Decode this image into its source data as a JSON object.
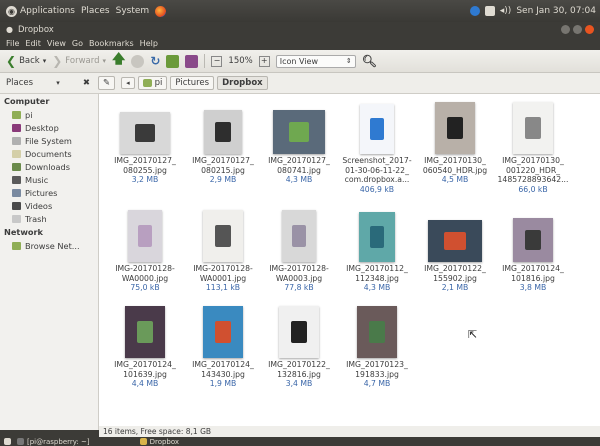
{
  "topbar": {
    "applications": "Applications",
    "places": "Places",
    "system": "System",
    "datetime": "Sen Jan 30, 07:04"
  },
  "window": {
    "title": "Dropbox"
  },
  "menu": [
    "File",
    "Edit",
    "View",
    "Go",
    "Bookmarks",
    "Help"
  ],
  "toolbar": {
    "back": "Back",
    "forward": "Forward",
    "zoom": "150%",
    "view_mode": "Icon View"
  },
  "location": {
    "places_label": "Places",
    "crumbs": [
      "pi",
      "Pictures",
      "Dropbox"
    ]
  },
  "sidebar": {
    "computer_header": "Computer",
    "computer_items": [
      "pi",
      "Desktop",
      "File System",
      "Documents",
      "Downloads",
      "Music",
      "Pictures",
      "Videos",
      "Trash"
    ],
    "network_header": "Network",
    "network_items": [
      "Browse Net..."
    ]
  },
  "files": [
    {
      "name1": "IMG_20170127_",
      "name2": "080255.jpg",
      "name3": "",
      "size": "3,2 MB"
    },
    {
      "name1": "IMG_20170127_",
      "name2": "080215.jpg",
      "name3": "",
      "size": "2,9 MB"
    },
    {
      "name1": "IMG_20170127_",
      "name2": "080741.jpg",
      "name3": "",
      "size": "4,3 MB"
    },
    {
      "name1": "Screenshot_2017-",
      "name2": "01-30-06-11-22_",
      "name3": "com.dropbox.a...",
      "size": "406,9 kB"
    },
    {
      "name1": "IMG_20170130_",
      "name2": "060540_HDR.jpg",
      "name3": "",
      "size": "4,5 MB"
    },
    {
      "name1": "IMG_20170130_",
      "name2": "001220_HDR_",
      "name3": "1485728893642...",
      "size": "66,0 kB"
    },
    {
      "name1": "IMG-20170128-",
      "name2": "WA0000.jpg",
      "name3": "",
      "size": "75,0 kB"
    },
    {
      "name1": "IMG-20170128-",
      "name2": "WA0001.jpg",
      "name3": "",
      "size": "113,1 kB"
    },
    {
      "name1": "IMG-20170128-",
      "name2": "WA0003.jpg",
      "name3": "",
      "size": "77,8 kB"
    },
    {
      "name1": "IMG_20170112_",
      "name2": "112348.jpg",
      "name3": "",
      "size": "4,3 MB"
    },
    {
      "name1": "IMG_20170122_",
      "name2": "155902.jpg",
      "name3": "",
      "size": "2,1 MB"
    },
    {
      "name1": "IMG_20170124_",
      "name2": "101816.jpg",
      "name3": "",
      "size": "3,8 MB"
    },
    {
      "name1": "IMG_20170124_",
      "name2": "101639.jpg",
      "name3": "",
      "size": "4,4 MB"
    },
    {
      "name1": "IMG_20170124_",
      "name2": "143430.jpg",
      "name3": "",
      "size": "1,9 MB"
    },
    {
      "name1": "IMG_20170122_",
      "name2": "132816.jpg",
      "name3": "",
      "size": "3,4 MB"
    },
    {
      "name1": "IMG_20170123_",
      "name2": "191833.jpg",
      "name3": "",
      "size": "4,7 MB"
    }
  ],
  "status": "16 items, Free space: 8,1 GB",
  "taskbar": {
    "terminal": "[pi@raspberry: ~]",
    "dropbox": "Dropbox"
  }
}
